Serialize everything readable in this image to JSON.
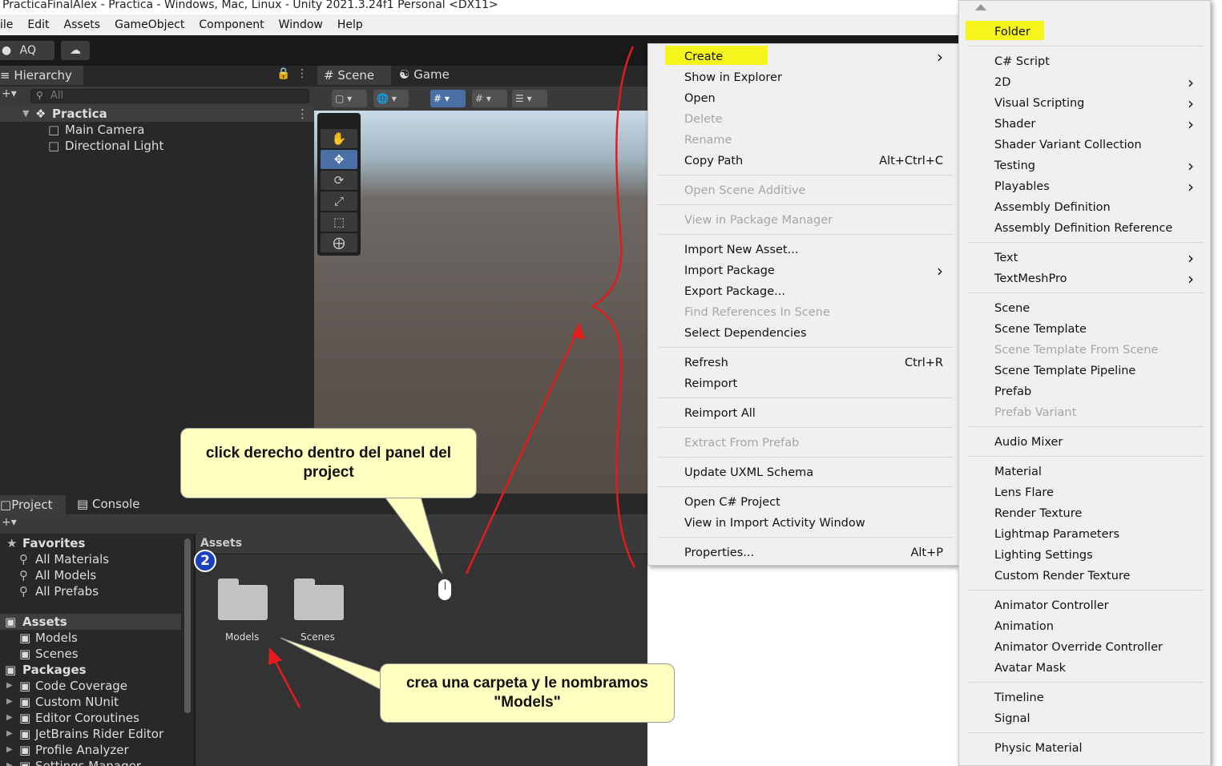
{
  "window": {
    "title": "PracticaFinalAlex - Practica - Windows, Mac, Linux - Unity 2021.3.24f1 Personal <DX11>"
  },
  "menubar": [
    "ile",
    "Edit",
    "Assets",
    "GameObject",
    "Component",
    "Window",
    "Help"
  ],
  "toolbar": {
    "account": "AQ"
  },
  "hierarchy": {
    "tab": "Hierarchy",
    "search_placeholder": "All",
    "scene": "Practica",
    "items": [
      "Main Camera",
      "Directional Light"
    ]
  },
  "scene_tabs": {
    "scene": "Scene",
    "game": "Game"
  },
  "project": {
    "tab_project": "Project",
    "tab_console": "Console",
    "favorites": {
      "label": "Favorites",
      "items": [
        "All Materials",
        "All Models",
        "All Prefabs"
      ]
    },
    "assets": {
      "label": "Assets",
      "items": [
        "Models",
        "Scenes"
      ]
    },
    "packages": {
      "label": "Packages",
      "items": [
        "Code Coverage",
        "Custom NUnit",
        "Editor Coroutines",
        "JetBrains Rider Editor",
        "Profile Analyzer",
        "Settings Manager"
      ]
    },
    "breadcrumb": "Assets",
    "folders": [
      "Models",
      "Scenes"
    ],
    "badge": "2"
  },
  "context_menu": {
    "items": [
      {
        "label": "Create",
        "submenu": true,
        "highlight": true
      },
      {
        "label": "Show in Explorer"
      },
      {
        "label": "Open"
      },
      {
        "label": "Delete",
        "disabled": true
      },
      {
        "label": "Rename",
        "disabled": true
      },
      {
        "label": "Copy Path",
        "shortcut": "Alt+Ctrl+C"
      },
      {
        "label": "Open Scene Additive",
        "disabled": true
      },
      {
        "label": "View in Package Manager",
        "disabled": true
      },
      {
        "label": "Import New Asset..."
      },
      {
        "label": "Import Package",
        "submenu": true
      },
      {
        "label": "Export Package..."
      },
      {
        "label": "Find References In Scene",
        "disabled": true
      },
      {
        "label": "Select Dependencies"
      },
      {
        "label": "Refresh",
        "shortcut": "Ctrl+R"
      },
      {
        "label": "Reimport"
      },
      {
        "label": "Reimport All"
      },
      {
        "label": "Extract From Prefab",
        "disabled": true
      },
      {
        "label": "Update UXML Schema"
      },
      {
        "label": "Open C# Project"
      },
      {
        "label": "View in Import Activity Window"
      },
      {
        "label": "Properties...",
        "shortcut": "Alt+P"
      }
    ]
  },
  "create_submenu": {
    "items": [
      {
        "label": "Folder",
        "highlight": true
      },
      {
        "label": "C# Script"
      },
      {
        "label": "2D",
        "submenu": true
      },
      {
        "label": "Visual Scripting",
        "submenu": true
      },
      {
        "label": "Shader",
        "submenu": true
      },
      {
        "label": "Shader Variant Collection"
      },
      {
        "label": "Testing",
        "submenu": true
      },
      {
        "label": "Playables",
        "submenu": true
      },
      {
        "label": "Assembly Definition"
      },
      {
        "label": "Assembly Definition Reference"
      },
      {
        "label": "Text",
        "submenu": true
      },
      {
        "label": "TextMeshPro",
        "submenu": true
      },
      {
        "label": "Scene"
      },
      {
        "label": "Scene Template"
      },
      {
        "label": "Scene Template From Scene",
        "disabled": true
      },
      {
        "label": "Scene Template Pipeline"
      },
      {
        "label": "Prefab"
      },
      {
        "label": "Prefab Variant",
        "disabled": true
      },
      {
        "label": "Audio Mixer"
      },
      {
        "label": "Material"
      },
      {
        "label": "Lens Flare"
      },
      {
        "label": "Render Texture"
      },
      {
        "label": "Lightmap Parameters"
      },
      {
        "label": "Lighting Settings"
      },
      {
        "label": "Custom Render Texture"
      },
      {
        "label": "Animator Controller"
      },
      {
        "label": "Animation"
      },
      {
        "label": "Animator Override Controller"
      },
      {
        "label": "Avatar Mask"
      },
      {
        "label": "Timeline"
      },
      {
        "label": "Signal"
      },
      {
        "label": "Physic Material"
      }
    ]
  },
  "annotations": {
    "callout_right_click": "click derecho dentro del panel del project",
    "callout_create_folder": "crea una carpeta y le nombramos \"Models\""
  },
  "colors": {
    "highlight": "#f5f51c",
    "annotation_red": "#e41b1b",
    "callout_bg": "#ffffc0"
  }
}
